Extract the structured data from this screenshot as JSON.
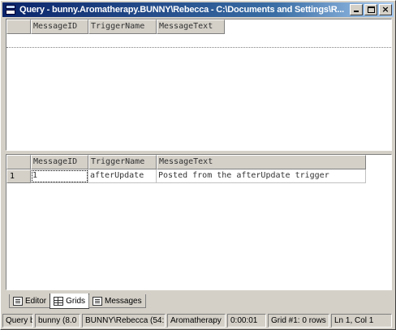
{
  "window": {
    "title": "Query - bunny.Aromatherapy.BUNNY\\Rebecca - C:\\Documents and Settings\\R..."
  },
  "top_grid": {
    "columns": [
      "MessageID",
      "TriggerName",
      "MessageText"
    ]
  },
  "bottom_grid": {
    "columns": [
      "MessageID",
      "TriggerName",
      "MessageText"
    ],
    "rows": [
      {
        "row_num": "1",
        "cells": [
          "1",
          "afterUpdate",
          "Posted from the afterUpdate trigger"
        ]
      }
    ]
  },
  "tabs": [
    {
      "label": "Editor",
      "icon": "editor-icon"
    },
    {
      "label": "Grids",
      "icon": "grid-icon"
    },
    {
      "label": "Messages",
      "icon": "messages-icon"
    }
  ],
  "status": [
    "Query b",
    "bunny (8.0",
    "BUNNY\\Rebecca (54:",
    "Aromatherapy",
    "0:00:01",
    "Grid #1: 0 rows",
    "Ln 1, Col 1"
  ]
}
